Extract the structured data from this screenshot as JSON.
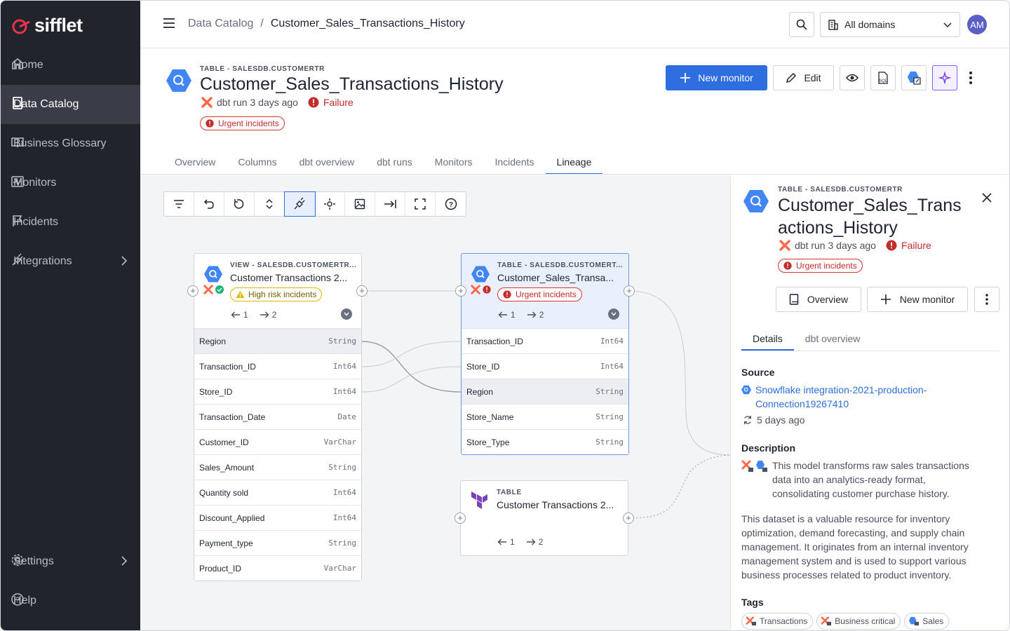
{
  "brand": {
    "name": "sifflet"
  },
  "sidebar": {
    "items": [
      {
        "label": "Home"
      },
      {
        "label": "Data Catalog"
      },
      {
        "label": "Business Glossary"
      },
      {
        "label": "Monitors"
      },
      {
        "label": "Incidents"
      },
      {
        "label": "Integrations"
      }
    ],
    "bottom": [
      {
        "label": "Settings"
      },
      {
        "label": "Help"
      }
    ],
    "active": "Data Catalog"
  },
  "header": {
    "breadcrumb": [
      "Data Catalog",
      "/",
      "Customer_Sales_Transactions_History"
    ],
    "domain_select": "All domains",
    "avatar": "AM"
  },
  "asset": {
    "type_label": "TABLE - SALESDB.CUSTOMERTR",
    "title": "Customer_Sales_Transactions_History",
    "dbt_run": "dbt run 3 days ago",
    "status": "Failure",
    "badge": "Urgent incidents"
  },
  "actions": {
    "new_monitor": "New monitor",
    "edit": "Edit",
    "sql_icon_label": "SQL"
  },
  "tabs": [
    "Overview",
    "Columns",
    "dbt overview",
    "dbt runs",
    "Monitors",
    "Incidents",
    "Lineage"
  ],
  "active_tab": "Lineage",
  "lineage": {
    "nodes": [
      {
        "type_label": "VIEW - SALESDB.CUSTOMERTR...",
        "title": "Customer Transactions 2...",
        "badge": "High risk incidents",
        "upstream": "1",
        "downstream": "2",
        "columns": [
          {
            "name": "Region",
            "type": "String"
          },
          {
            "name": "Transaction_ID",
            "type": "Int64"
          },
          {
            "name": "Store_ID",
            "type": "Int64"
          },
          {
            "name": "Transaction_Date",
            "type": "Date"
          },
          {
            "name": "Customer_ID",
            "type": "VarChar"
          },
          {
            "name": "Sales_Amount",
            "type": "String"
          },
          {
            "name": "Quantity sold",
            "type": "Int64"
          },
          {
            "name": "Discount_Applied",
            "type": "Int64"
          },
          {
            "name": "Payment_type",
            "type": "String"
          },
          {
            "name": "Product_ID",
            "type": "VarChar"
          }
        ]
      },
      {
        "type_label": "TABLE - SALESDB.CUSTOMERT...",
        "title": "Customer_Sales_Transa...",
        "badge": "Urgent incidents",
        "upstream": "1",
        "downstream": "2",
        "columns": [
          {
            "name": "Transaction_ID",
            "type": "Int64"
          },
          {
            "name": "Store_ID",
            "type": "Int64"
          },
          {
            "name": "Region",
            "type": "String"
          },
          {
            "name": "Store_Name",
            "type": "String"
          },
          {
            "name": "Store_Type",
            "type": "String"
          }
        ]
      },
      {
        "type_label": "TABLE",
        "title": "Customer Transactions 2...",
        "upstream": "1",
        "downstream": "2"
      }
    ]
  },
  "panel": {
    "type_label": "TABLE - SALESDB.CUSTOMERTR",
    "title": "Customer_Sales_Transactions_History",
    "dbt_run": "dbt run 3 days ago",
    "status": "Failure",
    "badge": "Urgent incidents",
    "overview_btn": "Overview",
    "new_monitor_btn": "New monitor",
    "tabs": [
      "Details",
      "dbt overview"
    ],
    "source_heading": "Source",
    "source_link": "Snowflake integration-2021-production-Connection19267410",
    "source_ago": "5 days ago",
    "description_heading": "Description",
    "description_short": "This model transforms raw sales transactions data into an analytics-ready format, consolidating customer purchase history.",
    "description_long": "This dataset is a valuable resource for inventory optimization, demand forecasting, and supply chain management. It originates from an internal inventory management system and is used to support various business processes related to product inventory.",
    "tags_heading": "Tags",
    "tags": [
      "Transactions",
      "Business critical",
      "Sales"
    ]
  },
  "colors": {
    "accent": "#2e6ee0",
    "failure": "#c42b2b",
    "sidebar": "#22242c",
    "warning": "#e5b800"
  }
}
